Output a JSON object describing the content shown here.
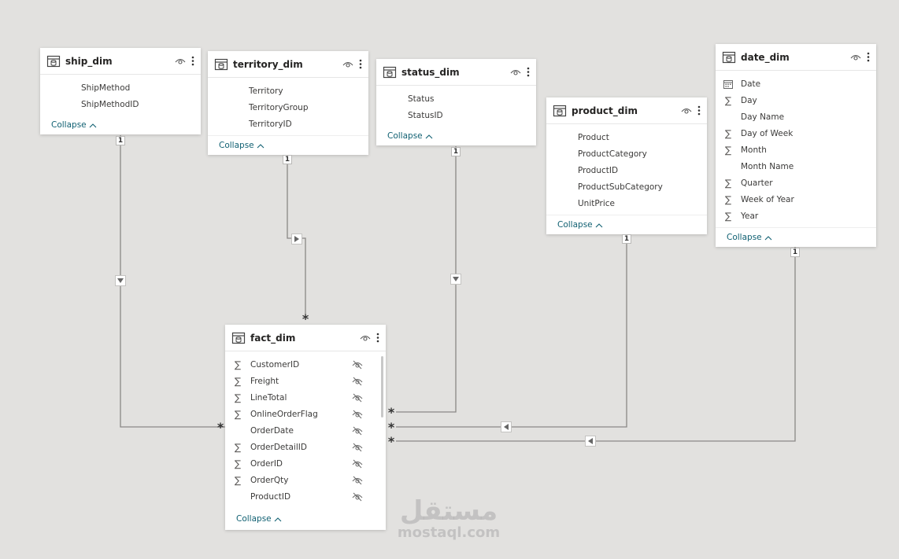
{
  "tables": [
    {
      "key": "ship",
      "name": "ship_dim",
      "fields": [
        {
          "label": "ShipMethod",
          "icon": "none"
        },
        {
          "label": "ShipMethodID",
          "icon": "none"
        }
      ],
      "collapse_label": "Collapse"
    },
    {
      "key": "territory",
      "name": "territory_dim",
      "fields": [
        {
          "label": "Territory",
          "icon": "none"
        },
        {
          "label": "TerritoryGroup",
          "icon": "none"
        },
        {
          "label": "TerritoryID",
          "icon": "none"
        }
      ],
      "collapse_label": "Collapse"
    },
    {
      "key": "status",
      "name": "status_dim",
      "fields": [
        {
          "label": "Status",
          "icon": "none"
        },
        {
          "label": "StatusID",
          "icon": "none"
        }
      ],
      "collapse_label": "Collapse"
    },
    {
      "key": "product",
      "name": "product_dim",
      "fields": [
        {
          "label": "Product",
          "icon": "none"
        },
        {
          "label": "ProductCategory",
          "icon": "none"
        },
        {
          "label": "ProductID",
          "icon": "none"
        },
        {
          "label": "ProductSubCategory",
          "icon": "none"
        },
        {
          "label": "UnitPrice",
          "icon": "none"
        }
      ],
      "collapse_label": "Collapse"
    },
    {
      "key": "date",
      "name": "date_dim",
      "fields": [
        {
          "label": "Date",
          "icon": "calendar-icon"
        },
        {
          "label": "Day",
          "icon": "sigma-icon"
        },
        {
          "label": "Day Name",
          "icon": "none"
        },
        {
          "label": "Day of Week",
          "icon": "sigma-icon"
        },
        {
          "label": "Month",
          "icon": "sigma-icon"
        },
        {
          "label": "Month Name",
          "icon": "none"
        },
        {
          "label": "Quarter",
          "icon": "sigma-icon"
        },
        {
          "label": "Week of Year",
          "icon": "sigma-icon"
        },
        {
          "label": "Year",
          "icon": "sigma-icon"
        }
      ],
      "collapse_label": "Collapse"
    },
    {
      "key": "fact",
      "name": "fact_dim",
      "fields": [
        {
          "label": "CustomerID",
          "icon": "sigma-icon",
          "hidden": true
        },
        {
          "label": "Freight",
          "icon": "sigma-icon",
          "hidden": true
        },
        {
          "label": "LineTotal",
          "icon": "sigma-icon",
          "hidden": true
        },
        {
          "label": "OnlineOrderFlag",
          "icon": "sigma-icon",
          "hidden": true
        },
        {
          "label": "OrderDate",
          "icon": "none",
          "hidden": true
        },
        {
          "label": "OrderDetailID",
          "icon": "sigma-icon",
          "hidden": true
        },
        {
          "label": "OrderID",
          "icon": "sigma-icon",
          "hidden": true
        },
        {
          "label": "OrderQty",
          "icon": "sigma-icon",
          "hidden": true
        },
        {
          "label": "ProductID",
          "icon": "none",
          "hidden": true
        }
      ],
      "collapse_label": "Collapse"
    }
  ],
  "relationships": [
    {
      "from": "ship_dim",
      "to": "fact_dim",
      "one": "1",
      "many": "*",
      "direction": "down"
    },
    {
      "from": "territory_dim",
      "to": "fact_dim",
      "one": "1",
      "many": "*",
      "direction": "right"
    },
    {
      "from": "status_dim",
      "to": "fact_dim",
      "one": "1",
      "many": "*",
      "direction": "down"
    },
    {
      "from": "product_dim",
      "to": "fact_dim",
      "one": "1",
      "many": "*",
      "direction": "left"
    },
    {
      "from": "date_dim",
      "to": "fact_dim",
      "one": "1",
      "many": "*",
      "direction": "left"
    }
  ],
  "watermark": {
    "arabic": "مستقل",
    "latin": "mostaql.com"
  },
  "colors": {
    "canvas": "#e2e1df",
    "link": "#106072",
    "line": "#8a8886"
  }
}
